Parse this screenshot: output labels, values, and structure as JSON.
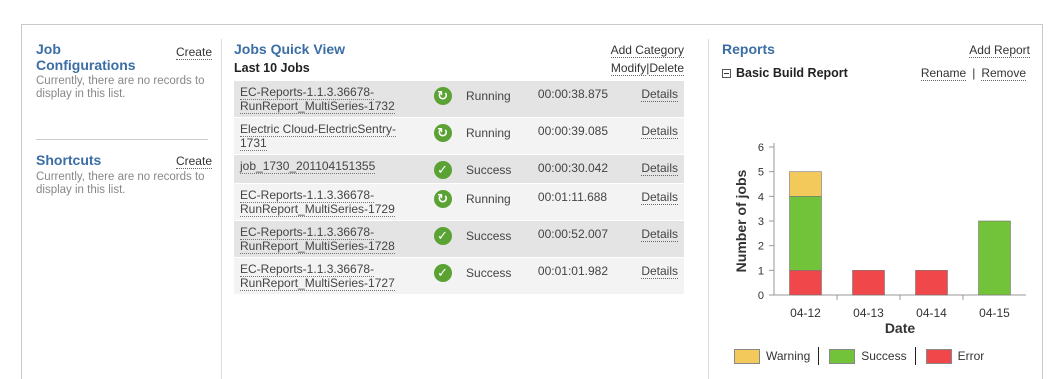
{
  "left": {
    "job_configurations": {
      "title": "Job Configurations",
      "create": "Create",
      "empty": "Currently, there are no records to display in this list."
    },
    "shortcuts": {
      "title": "Shortcuts",
      "create": "Create",
      "empty": "Currently, there are no records to display in this list."
    }
  },
  "quick_view": {
    "title": "Jobs Quick View",
    "add_category": "Add Category",
    "subtitle": "Last 10 Jobs",
    "modify": "Modify",
    "sep": "|",
    "delete": "Delete",
    "details_label": "Details",
    "jobs": [
      {
        "name": "EC-Reports-1.1.3.36678-RunReport_MultiSeries-1732",
        "status": "Running",
        "icon": "running-icon",
        "duration": "00:00:38.875"
      },
      {
        "name": "Electric Cloud-ElectricSentry-1731",
        "status": "Running",
        "icon": "running-icon",
        "duration": "00:00:39.085"
      },
      {
        "name": "job_1730_201104151355",
        "status": "Success",
        "icon": "success-check-icon",
        "duration": "00:00:30.042"
      },
      {
        "name": "EC-Reports-1.1.3.36678-RunReport_MultiSeries-1729",
        "status": "Running",
        "icon": "running-icon",
        "duration": "00:01:11.688"
      },
      {
        "name": "EC-Reports-1.1.3.36678-RunReport_MultiSeries-1728",
        "status": "Success",
        "icon": "success-check-icon",
        "duration": "00:00:52.007"
      },
      {
        "name": "EC-Reports-1.1.3.36678-RunReport_MultiSeries-1727",
        "status": "Success",
        "icon": "success-check-icon",
        "duration": "00:01:01.982"
      }
    ]
  },
  "reports": {
    "title": "Reports",
    "add_report": "Add Report",
    "report_name": "Basic Build Report",
    "rename": "Rename",
    "sep": "|",
    "remove": "Remove"
  },
  "chart_data": {
    "type": "bar",
    "stacked": true,
    "categories": [
      "04-12",
      "04-13",
      "04-14",
      "04-15"
    ],
    "series": [
      {
        "name": "Error",
        "color": "#f0484a",
        "values": [
          1,
          1,
          1,
          0
        ]
      },
      {
        "name": "Success",
        "color": "#72c23a",
        "values": [
          3,
          0,
          0,
          3
        ]
      },
      {
        "name": "Warning",
        "color": "#f2c95a",
        "values": [
          1,
          0,
          0,
          0
        ]
      }
    ],
    "legend_order": [
      "Warning",
      "Success",
      "Error"
    ],
    "xlabel": "Date",
    "ylabel": "Number of jobs",
    "ylim": [
      0,
      6
    ],
    "yticks": [
      0,
      1,
      2,
      3,
      4,
      5,
      6
    ],
    "legend": "bottom",
    "grid": false
  }
}
